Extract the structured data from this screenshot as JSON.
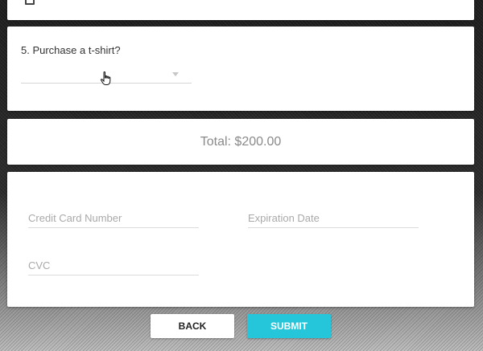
{
  "top_card": {
    "partial_label": "...y..."
  },
  "question": {
    "label": "5. Purchase a t-shirt?",
    "selected_value": ""
  },
  "total": {
    "text": "Total: $200.00"
  },
  "payment": {
    "card_number_placeholder": "Credit Card Number",
    "expiration_placeholder": "Expiration Date",
    "cvc_placeholder": "CVC"
  },
  "buttons": {
    "back_label": "BACK",
    "submit_label": "SUBMIT"
  },
  "colors": {
    "accent": "#26c6da",
    "card_bg": "#ffffff"
  },
  "icons": [
    "checkbox-icon",
    "chevron-down-icon",
    "hand-cursor-icon"
  ]
}
